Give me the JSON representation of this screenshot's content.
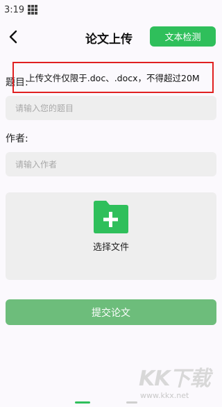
{
  "status_bar": {
    "time": "3:19"
  },
  "header": {
    "title": "论文上传",
    "detect_button": "文本检测"
  },
  "form": {
    "title_label": "题目:",
    "title_placeholder": "请输入您的题目",
    "author_label": "作者:",
    "author_placeholder": "请输入作者"
  },
  "upload": {
    "choose_label": "选择文件",
    "hint": "上传文件仅限于.doc、.docx，不得超过20M"
  },
  "submit_label": "提交论文",
  "watermark": {
    "brand": "KK下载",
    "url": "www.kkx.net"
  },
  "colors": {
    "accent": "#2fbf5b",
    "submit": "#6dbd7b",
    "highlight_border": "#e02020",
    "input_bg": "#eeeeee"
  }
}
